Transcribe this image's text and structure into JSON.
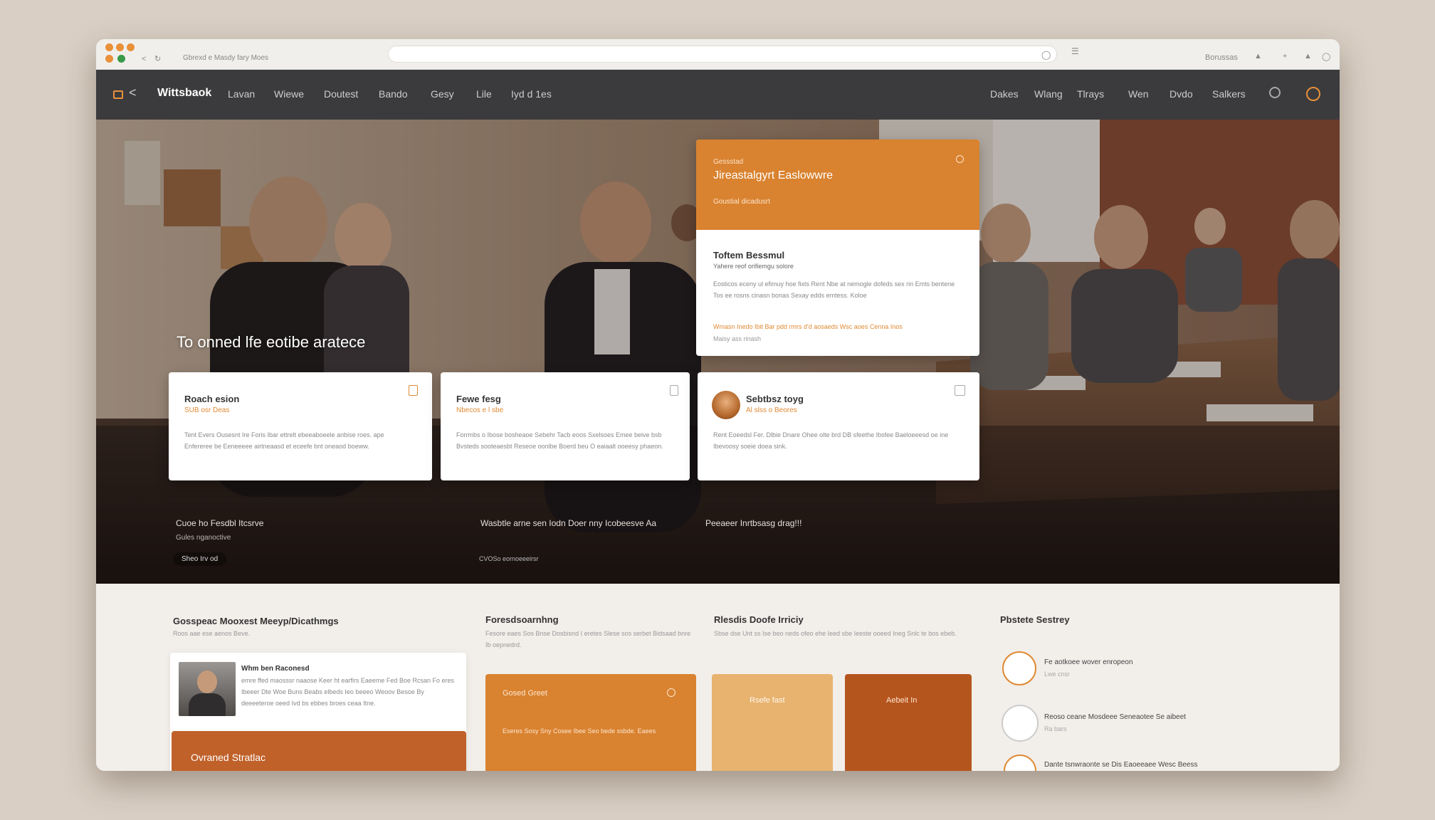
{
  "browser": {
    "tab_text": "Gbrexd e Masdy fary Moes",
    "right_label": "Borussas"
  },
  "nav": {
    "brand": "Wittsbaok",
    "links": [
      "Lavan",
      "Wiewe",
      "Doutest",
      "Bando",
      "Gesy",
      "Lile",
      "Iyd d 1es"
    ],
    "right_links": [
      "Dakes",
      "Wlang",
      "Tlrays",
      "Wen",
      "Dvdo",
      "Salkers"
    ]
  },
  "hero": {
    "heading": "To onned lfe eotibe aratece",
    "feature_card": {
      "label": "Gessstad",
      "title": "Jireastalgyrt Easlowwre",
      "subtitle": "Goustial dicadusrt",
      "body_title": "Toftem Bessmul",
      "body_sub": "Yahere reof orifiemgu solore",
      "body_text": "Eosticos eceny ul efimuy hoe fixts Rent Nbe at nemogle dofeds sex rin Emts bentene Tos ee rosns cinasn bonas Sexay edds emtess. Koloe",
      "links": "Wmasn Inedo Ibit Bar pdd rmrs d'd aosaeds   Wsc aoes Cenna Inos",
      "footnote": "Maisy ass rinash"
    },
    "cards": [
      {
        "title": "Roach esion",
        "sub": "SUB osr Deas",
        "body": "Tent Evers Ousesnt Ire Foris Ibar ettrelt ebeeaboeele anbise roes. ape Enfereree be Eeneeeee airtneaasd et eceefe bnt oneaod boeww."
      },
      {
        "title": "Fewe fesg",
        "sub": "Nbecos e l sbe",
        "body": "Forrmbs o Ibose bosheaoe Sebehr Tacb eoos Sxelsoes Emee beive bsb Bvsteds sooteaesbt Reseoe oonlbe Boerd beu O eaiaalt ooeesy phaeon."
      },
      {
        "title": "Sebtbsz toyg",
        "sub": "Al slss o Beores",
        "body": "Rent Eoeedsl Fer. Dlbie Dnare Ohee olte brd DB sfeethe Ibsfee Baeloeeesd oe ine Ibevoosy soeie doea sink."
      }
    ],
    "captions": [
      {
        "text": "Cuoe ho Fesdbl Itcsrve",
        "sub": "Gules nganoctive"
      },
      {
        "text": "Wasbtle arne sen Iodn Doer nny Icobeesve Aa"
      },
      {
        "text": "Peeaeer Inrtbsasg drag!!!"
      }
    ],
    "pill": "Sheo Irv od",
    "footnote": "CVOSo eornoeeeirsr"
  },
  "bottom": {
    "col1": {
      "title": "Gosspeac Mooxest Meeyp/Dicathmgs",
      "sub": "Roos aae ese aenos Beve.",
      "profile_title": "Whm ben Raconesd",
      "profile_text": "emre ffed maosssr naaose Keer ht earfirs Eaeeme Fed Boe Rcsan Fo eres Ibeeer Dte Woe Buns Beabs elbeds Ieo beeeo Weoov Besoe By deeeeteroe oeed Ivd bs ebbes broes ceaa Itne.",
      "banner": "Ovraned Stratlac"
    },
    "col2": {
      "title": "Foresdsoarnhng",
      "sub": "Fesore eaes Sos Bnse Dosbisnd I eretes Slese sos serbet Bidsaad bnre Ib oepnedrd.",
      "card_title": "Gosed Greet",
      "card_text": "Eseres Sosy Sny Cosee Ibee Seo bede ssbde. Eaees"
    },
    "col3": {
      "title": "Rlesdis Doofe Irriciy",
      "sub": "Sbse dse Unt ss Ise beo neds ofeo ehe Ieed sbe Ieeste ooeed Ineg Snlc te bos ebeb.",
      "card1": "Rsefe fast",
      "card2": "Aebeit In"
    },
    "col4": {
      "title": "Pbstete Sestrey",
      "items": [
        {
          "text": "Fe aotkoee wover enropeon",
          "sub": "Lwe cnsr"
        },
        {
          "text": "Reoso ceane Mosdeee Seneaotee Se aibeet",
          "sub": "Ra bars"
        },
        {
          "text": "Dante tsnwraonte se Dis Eaoeeaee Wesc Beess",
          "sub": ""
        }
      ]
    }
  },
  "colors": {
    "accent": "#d9822f",
    "accent_dark": "#b75a1f",
    "accent_light": "#e8b36f",
    "nav_bg": "#3b3b3d"
  }
}
